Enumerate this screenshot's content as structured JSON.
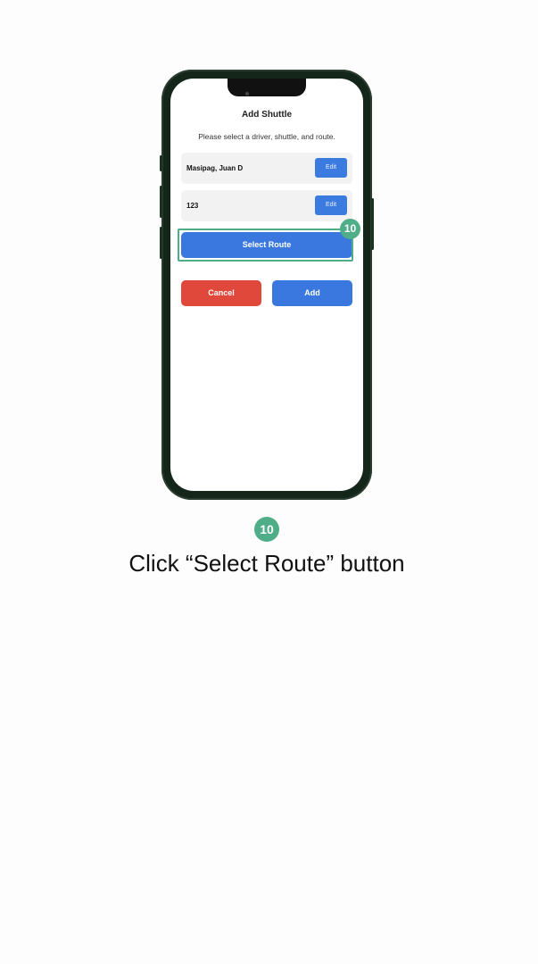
{
  "screen": {
    "title": "Add Shuttle",
    "subtitle": "Please select a driver, shuttle, and route.",
    "driver_row": {
      "value": "Masipag, Juan D",
      "edit_label": "Edit"
    },
    "shuttle_row": {
      "value": "123",
      "edit_label": "Edit"
    },
    "select_route_label": "Select Route",
    "cancel_label": "Cancel",
    "add_label": "Add"
  },
  "tutorial": {
    "step_number": "10",
    "instruction": "Click “Select Route” button"
  },
  "colors": {
    "primary_blue": "#3a78e0",
    "danger_red": "#e0483b",
    "highlight_green": "#4fae88"
  }
}
